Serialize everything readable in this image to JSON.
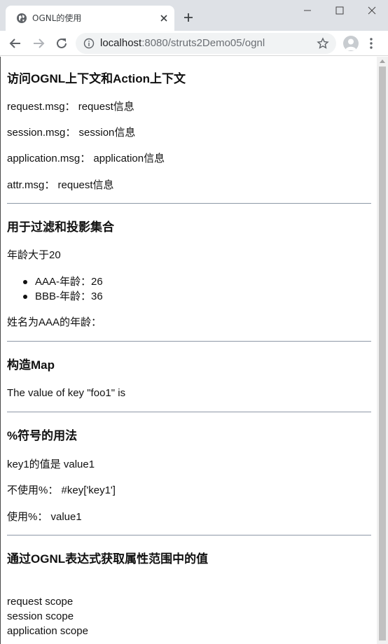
{
  "browser": {
    "tab_title": "OGNL的使用",
    "url_host": "localhost",
    "url_rest": ":8080/struts2Demo05/ognl"
  },
  "section1": {
    "heading": "访问OGNL上下文和Action上下文",
    "lines": [
      "request.msg：  request信息",
      "session.msg：  session信息",
      "application.msg：  application信息",
      "attr.msg：  request信息"
    ]
  },
  "section2": {
    "heading": "用于过滤和投影集合",
    "intro": "年龄大于20",
    "items": [
      "AAA-年龄：26",
      "BBB-年龄：36"
    ],
    "outro": "姓名为AAA的年龄："
  },
  "section3": {
    "heading": "构造Map",
    "line": "The value of key \"foo1\" is"
  },
  "section4": {
    "heading": "%符号的用法",
    "lines": [
      "key1的值是 value1",
      "不使用%：  #key['key1']",
      "使用%：  value1"
    ]
  },
  "section5": {
    "heading": "通过OGNL表达式获取属性范围中的值",
    "scopes": [
      "request scope",
      "session scope",
      "application scope"
    ]
  }
}
